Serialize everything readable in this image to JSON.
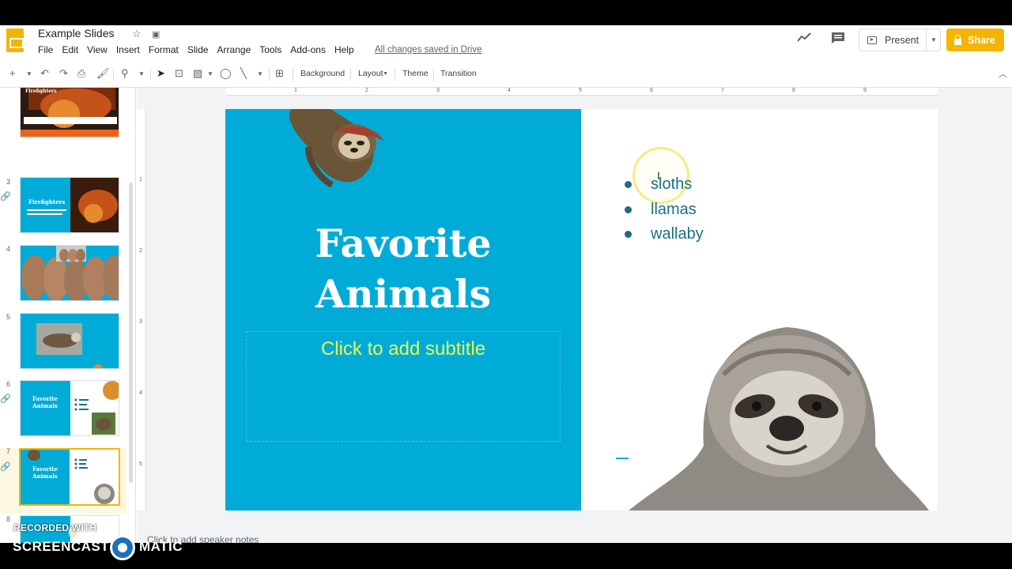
{
  "header": {
    "doc_title": "Example Slides",
    "star_icon": "star-icon",
    "folder_icon": "move-to-folder-icon",
    "menu": [
      "File",
      "Edit",
      "View",
      "Insert",
      "Format",
      "Slide",
      "Arrange",
      "Tools",
      "Add-ons",
      "Help"
    ],
    "saved_status": "All changes saved in Drive",
    "present_label": "Present",
    "share_label": "Share",
    "accent_color": "#f4b400"
  },
  "toolbar": {
    "background_label": "Background",
    "layout_label": "Layout",
    "theme_label": "Theme",
    "transition_label": "Transition"
  },
  "ruler": {
    "top_ticks": [
      "1",
      "2",
      "3",
      "4",
      "5",
      "6",
      "7",
      "8",
      "9"
    ],
    "left_ticks": [
      "1",
      "2",
      "3",
      "4",
      "5"
    ]
  },
  "filmstrip": {
    "slide_numbers": [
      "3",
      "4",
      "5",
      "6",
      "7",
      "8"
    ],
    "selected_slide": "7",
    "thumb2_title": "Firefighters",
    "thumb3_title": "Firefighters",
    "thumb6_title": "Favorite Animals",
    "thumb7_title": "Favorite Animals"
  },
  "slide": {
    "title_line1": "Favorite",
    "title_line2": "Animals",
    "subtitle_placeholder": "Click to add subtitle",
    "bullets": [
      "sloths",
      "llamas",
      "wallaby"
    ],
    "left_panel_color": "#00acd7",
    "title_color": "#ffffff",
    "subtitle_color": "#e8f551",
    "bullet_color": "#1b6e86"
  },
  "notes": {
    "placeholder": "Click to add speaker notes"
  },
  "watermark": {
    "line1": "RECORDED WITH",
    "line2a": "SCREENCAST",
    "line2b": "MATIC"
  }
}
